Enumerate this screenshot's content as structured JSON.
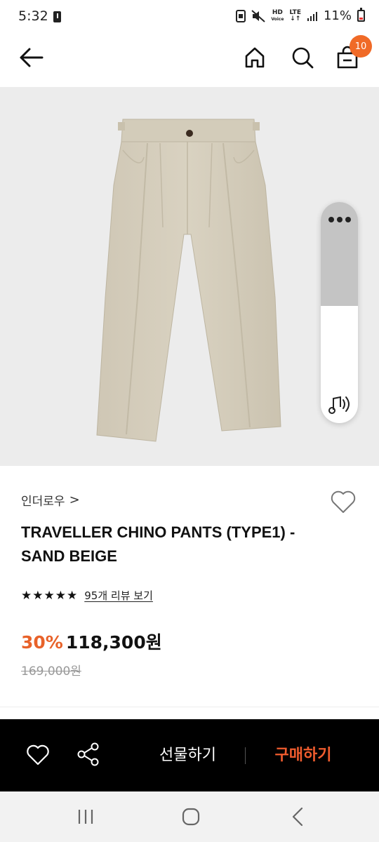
{
  "status_bar": {
    "time": "5:32",
    "network_hd": "HD",
    "network_voice": "Voice",
    "network_lte": "LTE",
    "battery": "11%"
  },
  "header": {
    "cart_count": "10"
  },
  "product": {
    "brand": "인더로우",
    "brand_chevron": ">",
    "title": "TRAVELLER CHINO PANTS (TYPE1) - SAND BEIGE",
    "rating_stars": 5,
    "review_link": "95개 리뷰 보기",
    "discount": "30%",
    "sale_price": "118,300원",
    "original_price": "169,000원",
    "image_subject": "beige chino pants"
  },
  "volume_panel": {
    "level": 0.5
  },
  "action_bar": {
    "gift_label": "선물하기",
    "buy_label": "구매하기"
  },
  "colors": {
    "accent": "#f06a27",
    "discount": "#e8622a",
    "buy": "#ef5c2e",
    "action_bar_bg": "#000000"
  },
  "icons": [
    "back-arrow-icon",
    "home-icon",
    "search-icon",
    "shopping-bag-icon",
    "heart-icon",
    "share-icon",
    "more-icon",
    "sound-icon",
    "recent-apps-icon",
    "nav-home-icon",
    "nav-back-icon"
  ]
}
